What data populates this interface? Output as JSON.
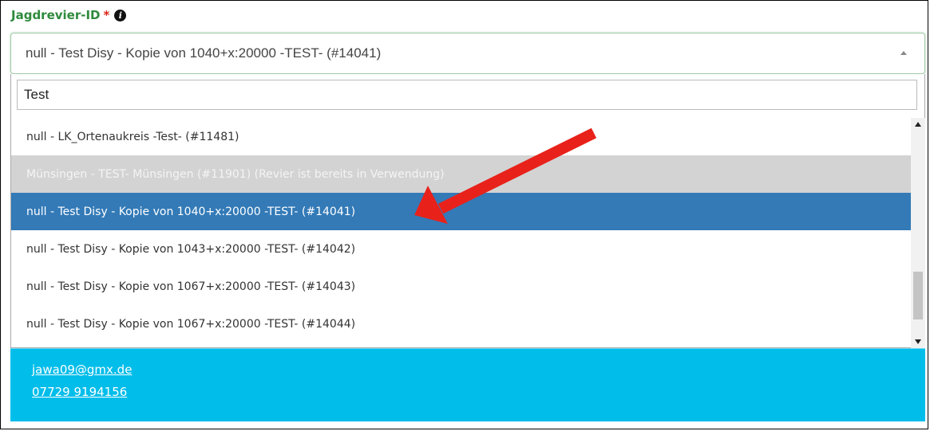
{
  "field": {
    "label": "Jagdrevier-ID",
    "required_marker": "*",
    "info_icon": "info-circle-icon"
  },
  "select": {
    "value": "null - Test Disy - Kopie von 1040+x:20000 -TEST- (#14041)",
    "caret_icon": "caret-up-icon"
  },
  "search": {
    "value": "Test"
  },
  "options": [
    {
      "label": "null - LK_Ortenaukreis -Test- (#11481)",
      "state": "normal"
    },
    {
      "label": "Münsingen - TEST- Münsingen (#11901) (Revier ist bereits in Verwendung)",
      "state": "disabled"
    },
    {
      "label": "null - Test Disy - Kopie von 1040+x:20000 -TEST- (#14041)",
      "state": "selected"
    },
    {
      "label": "null - Test Disy - Kopie von 1043+x:20000 -TEST- (#14042)",
      "state": "normal"
    },
    {
      "label": "null - Test Disy - Kopie von 1067+x:20000 -TEST- (#14043)",
      "state": "normal"
    },
    {
      "label": "null - Test Disy - Kopie von 1067+x:20000 -TEST- (#14044)",
      "state": "normal"
    }
  ],
  "contact": {
    "email": "jawa09@gmx.de",
    "phone": "07729 9194156"
  },
  "colors": {
    "label_green": "#2e8a3c",
    "required_red": "#d9261c",
    "selected_blue": "#337ab7",
    "disabled_gray": "#d3d3d3",
    "panel_cyan": "#00bdea",
    "annotation_arrow": "#e8221b"
  }
}
